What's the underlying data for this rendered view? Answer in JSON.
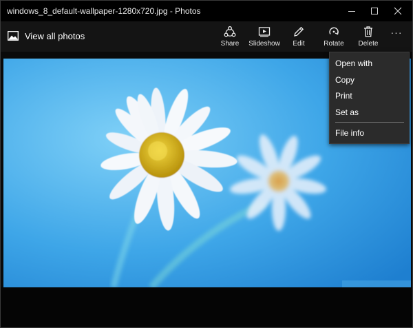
{
  "window": {
    "title": "windows_8_default-wallpaper-1280x720.jpg - Photos"
  },
  "toolbar": {
    "view_all_label": "View all photos",
    "actions": [
      {
        "label": "Share",
        "icon": "share-icon"
      },
      {
        "label": "Slideshow",
        "icon": "slideshow-icon"
      },
      {
        "label": "Edit",
        "icon": "pencil-icon"
      },
      {
        "label": "Rotate",
        "icon": "rotate-icon"
      },
      {
        "label": "Delete",
        "icon": "trash-icon"
      }
    ],
    "more_label": "···"
  },
  "menu": {
    "items": [
      "Open with",
      "Copy",
      "Print",
      "Set as",
      "File info"
    ]
  },
  "colors": {
    "titlebar": "#000000",
    "toolbar": "#141414",
    "menu_bg": "#2b2b2b",
    "sky_light": "#6fc6f4",
    "sky_dark": "#2a8fd8",
    "petal": "#f4f7fb",
    "flower_center": "#e8c21a"
  }
}
